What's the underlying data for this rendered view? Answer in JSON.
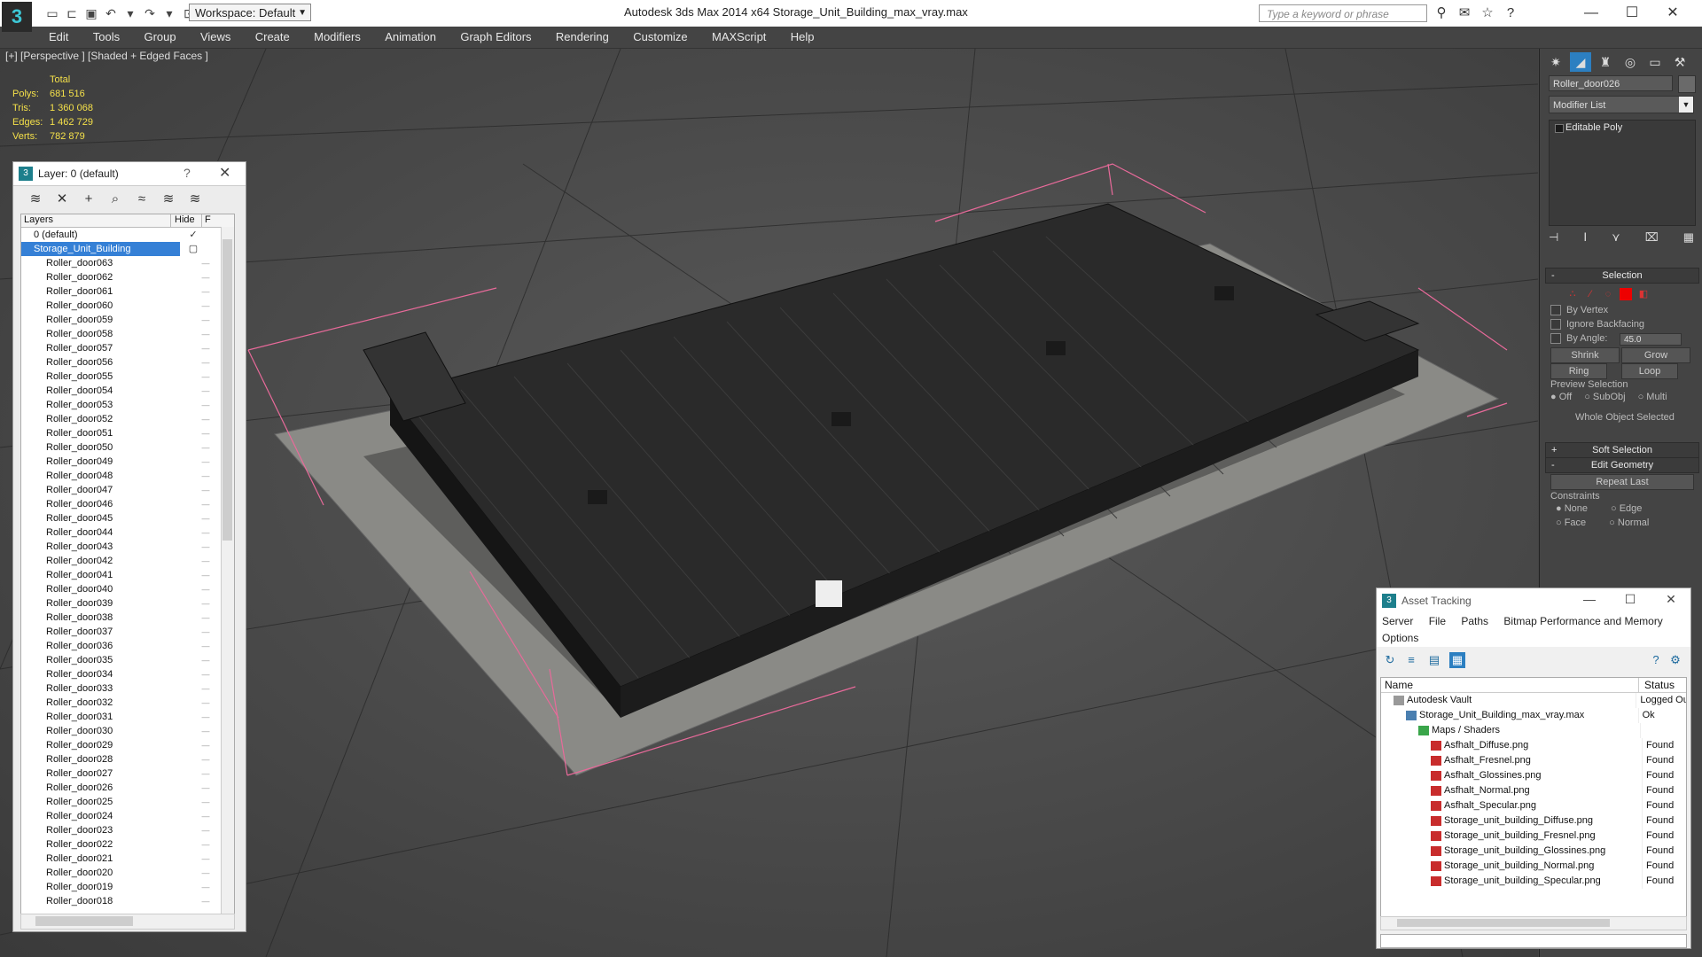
{
  "app": {
    "title": "Autodesk 3ds Max  2014 x64      Storage_Unit_Building_max_vray.max",
    "logo_icon": "3dsmax-logo-icon",
    "workspace": "Workspace: Default",
    "search_placeholder": "Type a keyword or phrase"
  },
  "menu": [
    "Edit",
    "Tools",
    "Group",
    "Views",
    "Create",
    "Modifiers",
    "Animation",
    "Graph Editors",
    "Rendering",
    "Customize",
    "MAXScript",
    "Help"
  ],
  "viewport": {
    "label": "[+] [Perspective ] [Shaded + Edged Faces ]",
    "stats": {
      "total_label": "Total",
      "rows": [
        {
          "label": "Polys:",
          "value": "681 516"
        },
        {
          "label": "Tris:",
          "value": "1 360 068"
        },
        {
          "label": "Edges:",
          "value": "1 462 729"
        },
        {
          "label": "Verts:",
          "value": "782 879"
        }
      ]
    }
  },
  "layer_panel": {
    "title": "Layer: 0 (default)",
    "help": "?",
    "col_layers": "Layers",
    "col_hide": "Hide",
    "col_f": "F",
    "rows": [
      {
        "name": "0 (default)",
        "indent": 1,
        "selected": false,
        "mark": "✓"
      },
      {
        "name": "Storage_Unit_Building",
        "indent": 1,
        "selected": true,
        "mark": "▢"
      },
      {
        "name": "Roller_door063",
        "indent": 2
      },
      {
        "name": "Roller_door062",
        "indent": 2
      },
      {
        "name": "Roller_door061",
        "indent": 2
      },
      {
        "name": "Roller_door060",
        "indent": 2
      },
      {
        "name": "Roller_door059",
        "indent": 2
      },
      {
        "name": "Roller_door058",
        "indent": 2
      },
      {
        "name": "Roller_door057",
        "indent": 2
      },
      {
        "name": "Roller_door056",
        "indent": 2
      },
      {
        "name": "Roller_door055",
        "indent": 2
      },
      {
        "name": "Roller_door054",
        "indent": 2
      },
      {
        "name": "Roller_door053",
        "indent": 2
      },
      {
        "name": "Roller_door052",
        "indent": 2
      },
      {
        "name": "Roller_door051",
        "indent": 2
      },
      {
        "name": "Roller_door050",
        "indent": 2
      },
      {
        "name": "Roller_door049",
        "indent": 2
      },
      {
        "name": "Roller_door048",
        "indent": 2
      },
      {
        "name": "Roller_door047",
        "indent": 2
      },
      {
        "name": "Roller_door046",
        "indent": 2
      },
      {
        "name": "Roller_door045",
        "indent": 2
      },
      {
        "name": "Roller_door044",
        "indent": 2
      },
      {
        "name": "Roller_door043",
        "indent": 2
      },
      {
        "name": "Roller_door042",
        "indent": 2
      },
      {
        "name": "Roller_door041",
        "indent": 2
      },
      {
        "name": "Roller_door040",
        "indent": 2
      },
      {
        "name": "Roller_door039",
        "indent": 2
      },
      {
        "name": "Roller_door038",
        "indent": 2
      },
      {
        "name": "Roller_door037",
        "indent": 2
      },
      {
        "name": "Roller_door036",
        "indent": 2
      },
      {
        "name": "Roller_door035",
        "indent": 2
      },
      {
        "name": "Roller_door034",
        "indent": 2
      },
      {
        "name": "Roller_door033",
        "indent": 2
      },
      {
        "name": "Roller_door032",
        "indent": 2
      },
      {
        "name": "Roller_door031",
        "indent": 2
      },
      {
        "name": "Roller_door030",
        "indent": 2
      },
      {
        "name": "Roller_door029",
        "indent": 2
      },
      {
        "name": "Roller_door028",
        "indent": 2
      },
      {
        "name": "Roller_door027",
        "indent": 2
      },
      {
        "name": "Roller_door026",
        "indent": 2
      },
      {
        "name": "Roller_door025",
        "indent": 2
      },
      {
        "name": "Roller_door024",
        "indent": 2
      },
      {
        "name": "Roller_door023",
        "indent": 2
      },
      {
        "name": "Roller_door022",
        "indent": 2
      },
      {
        "name": "Roller_door021",
        "indent": 2
      },
      {
        "name": "Roller_door020",
        "indent": 2
      },
      {
        "name": "Roller_door019",
        "indent": 2
      },
      {
        "name": "Roller_door018",
        "indent": 2
      }
    ]
  },
  "command_panel": {
    "object_name": "Roller_door026",
    "modifier_list": "Modifier List",
    "stack": [
      "Editable Poly"
    ],
    "selection": {
      "title": "Selection",
      "by_vertex": "By Vertex",
      "ignore_backfacing": "Ignore Backfacing",
      "by_angle": "By Angle:",
      "angle_value": "45.0",
      "shrink": "Shrink",
      "grow": "Grow",
      "ring": "Ring",
      "loop": "Loop",
      "preview_label": "Preview Selection",
      "preview_off": "Off",
      "preview_subobj": "SubObj",
      "preview_multi": "Multi",
      "whole_object": "Whole Object Selected"
    },
    "soft_selection": "Soft Selection",
    "edit_geometry": {
      "title": "Edit Geometry",
      "repeat_last": "Repeat Last",
      "constraints": "Constraints",
      "none": "None",
      "edge": "Edge",
      "face": "Face",
      "normal": "Normal"
    }
  },
  "asset_tracking": {
    "title": "Asset Tracking",
    "menu": [
      "Server",
      "File",
      "Paths",
      "Bitmap Performance and Memory"
    ],
    "menu2": "Options",
    "col_name": "Name",
    "col_status": "Status",
    "rows": [
      {
        "name": "Autodesk Vault",
        "status": "Logged Ou",
        "indent": 1,
        "icon": "root"
      },
      {
        "name": "Storage_Unit_Building_max_vray.max",
        "status": "Ok",
        "indent": 2,
        "icon": "max"
      },
      {
        "name": "Maps / Shaders",
        "status": "",
        "indent": 3,
        "icon": "maps"
      },
      {
        "name": "Asfhalt_Diffuse.png",
        "status": "Found",
        "indent": 4,
        "icon": "png"
      },
      {
        "name": "Asfhalt_Fresnel.png",
        "status": "Found",
        "indent": 4,
        "icon": "png"
      },
      {
        "name": "Asfhalt_Glossines.png",
        "status": "Found",
        "indent": 4,
        "icon": "png"
      },
      {
        "name": "Asfhalt_Normal.png",
        "status": "Found",
        "indent": 4,
        "icon": "png"
      },
      {
        "name": "Asfhalt_Specular.png",
        "status": "Found",
        "indent": 4,
        "icon": "png"
      },
      {
        "name": "Storage_unit_building_Diffuse.png",
        "status": "Found",
        "indent": 4,
        "icon": "png"
      },
      {
        "name": "Storage_unit_building_Fresnel.png",
        "status": "Found",
        "indent": 4,
        "icon": "png"
      },
      {
        "name": "Storage_unit_building_Glossines.png",
        "status": "Found",
        "indent": 4,
        "icon": "png"
      },
      {
        "name": "Storage_unit_building_Normal.png",
        "status": "Found",
        "indent": 4,
        "icon": "png"
      },
      {
        "name": "Storage_unit_building_Specular.png",
        "status": "Found",
        "indent": 4,
        "icon": "png"
      }
    ]
  }
}
